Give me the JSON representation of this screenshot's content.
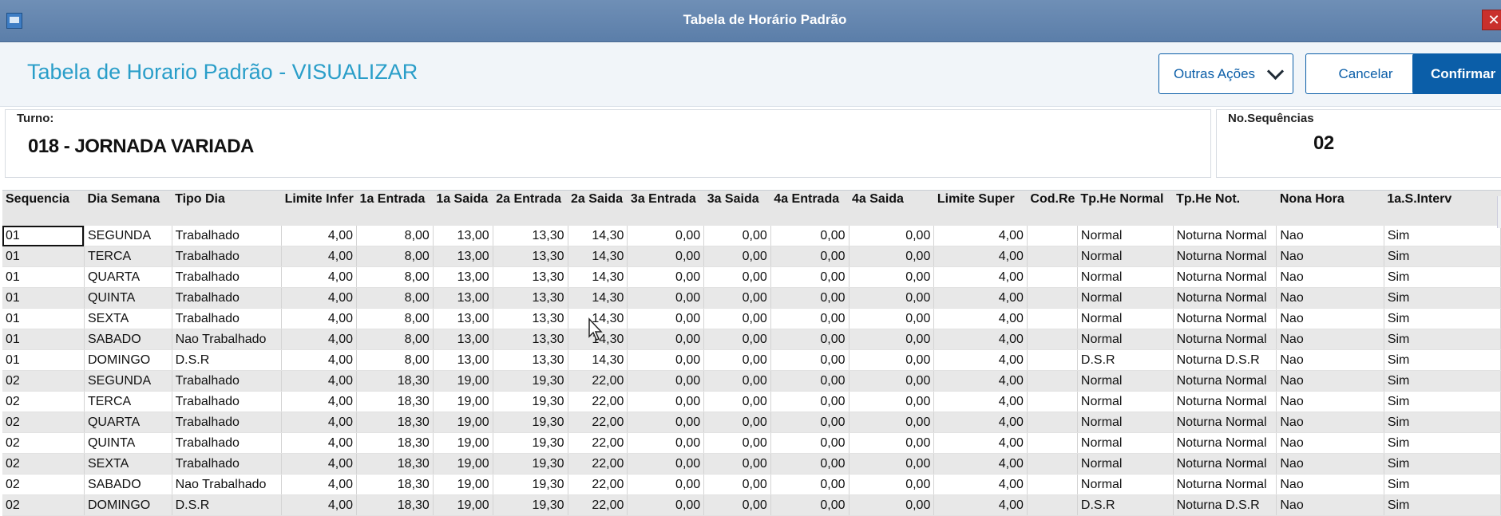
{
  "window": {
    "title": "Tabela de Horário Padrão"
  },
  "page": {
    "title": "Tabela de Horario Padrão - VISUALIZAR"
  },
  "buttons": {
    "outras": "Outras Ações",
    "cancelar": "Cancelar",
    "confirmar": "Confirmar"
  },
  "turno": {
    "label": "Turno:",
    "value": "018 - JORNADA VARIADA"
  },
  "sequencias": {
    "label": "No.Sequências",
    "value": "02"
  },
  "table": {
    "headers": [
      "Sequencia",
      "Dia Semana",
      "Tipo Dia",
      "Limite Infer",
      "1a Entrada",
      "1a Saida",
      "2a Entrada",
      "2a Saida",
      "3a Entrada",
      "3a Saida",
      "4a Entrada",
      "4a Saida",
      "Limite Super",
      "Cod.Re",
      "Tp.He Normal",
      "Tp.He Not.",
      "Nona Hora",
      "1a.S.Interv"
    ],
    "rows": [
      [
        "01",
        "SEGUNDA",
        "Trabalhado",
        "4,00",
        "8,00",
        "13,00",
        "13,30",
        "14,30",
        "0,00",
        "0,00",
        "0,00",
        "0,00",
        "4,00",
        "",
        "Normal",
        "Noturna Normal",
        "Nao",
        "Sim"
      ],
      [
        "01",
        "TERCA",
        "Trabalhado",
        "4,00",
        "8,00",
        "13,00",
        "13,30",
        "14,30",
        "0,00",
        "0,00",
        "0,00",
        "0,00",
        "4,00",
        "",
        "Normal",
        "Noturna Normal",
        "Nao",
        "Sim"
      ],
      [
        "01",
        "QUARTA",
        "Trabalhado",
        "4,00",
        "8,00",
        "13,00",
        "13,30",
        "14,30",
        "0,00",
        "0,00",
        "0,00",
        "0,00",
        "4,00",
        "",
        "Normal",
        "Noturna Normal",
        "Nao",
        "Sim"
      ],
      [
        "01",
        "QUINTA",
        "Trabalhado",
        "4,00",
        "8,00",
        "13,00",
        "13,30",
        "14,30",
        "0,00",
        "0,00",
        "0,00",
        "0,00",
        "4,00",
        "",
        "Normal",
        "Noturna Normal",
        "Nao",
        "Sim"
      ],
      [
        "01",
        "SEXTA",
        "Trabalhado",
        "4,00",
        "8,00",
        "13,00",
        "13,30",
        "14,30",
        "0,00",
        "0,00",
        "0,00",
        "0,00",
        "4,00",
        "",
        "Normal",
        "Noturna Normal",
        "Nao",
        "Sim"
      ],
      [
        "01",
        "SABADO",
        "Nao Trabalhado",
        "4,00",
        "8,00",
        "13,00",
        "13,30",
        "14,30",
        "0,00",
        "0,00",
        "0,00",
        "0,00",
        "4,00",
        "",
        "Normal",
        "Noturna Normal",
        "Nao",
        "Sim"
      ],
      [
        "01",
        "DOMINGO",
        "D.S.R",
        "4,00",
        "8,00",
        "13,00",
        "13,30",
        "14,30",
        "0,00",
        "0,00",
        "0,00",
        "0,00",
        "4,00",
        "",
        "D.S.R",
        "Noturna D.S.R",
        "Nao",
        "Sim"
      ],
      [
        "02",
        "SEGUNDA",
        "Trabalhado",
        "4,00",
        "18,30",
        "19,00",
        "19,30",
        "22,00",
        "0,00",
        "0,00",
        "0,00",
        "0,00",
        "4,00",
        "",
        "Normal",
        "Noturna Normal",
        "Nao",
        "Sim"
      ],
      [
        "02",
        "TERCA",
        "Trabalhado",
        "4,00",
        "18,30",
        "19,00",
        "19,30",
        "22,00",
        "0,00",
        "0,00",
        "0,00",
        "0,00",
        "4,00",
        "",
        "Normal",
        "Noturna Normal",
        "Nao",
        "Sim"
      ],
      [
        "02",
        "QUARTA",
        "Trabalhado",
        "4,00",
        "18,30",
        "19,00",
        "19,30",
        "22,00",
        "0,00",
        "0,00",
        "0,00",
        "0,00",
        "4,00",
        "",
        "Normal",
        "Noturna Normal",
        "Nao",
        "Sim"
      ],
      [
        "02",
        "QUINTA",
        "Trabalhado",
        "4,00",
        "18,30",
        "19,00",
        "19,30",
        "22,00",
        "0,00",
        "0,00",
        "0,00",
        "0,00",
        "4,00",
        "",
        "Normal",
        "Noturna Normal",
        "Nao",
        "Sim"
      ],
      [
        "02",
        "SEXTA",
        "Trabalhado",
        "4,00",
        "18,30",
        "19,00",
        "19,30",
        "22,00",
        "0,00",
        "0,00",
        "0,00",
        "0,00",
        "4,00",
        "",
        "Normal",
        "Noturna Normal",
        "Nao",
        "Sim"
      ],
      [
        "02",
        "SABADO",
        "Nao Trabalhado",
        "4,00",
        "18,30",
        "19,00",
        "19,30",
        "22,00",
        "0,00",
        "0,00",
        "0,00",
        "0,00",
        "4,00",
        "",
        "Normal",
        "Noturna Normal",
        "Nao",
        "Sim"
      ],
      [
        "02",
        "DOMINGO",
        "D.S.R",
        "4,00",
        "18,30",
        "19,00",
        "19,30",
        "22,00",
        "0,00",
        "0,00",
        "0,00",
        "0,00",
        "4,00",
        "",
        "D.S.R",
        "Noturna D.S.R",
        "Nao",
        "Sim"
      ]
    ]
  }
}
